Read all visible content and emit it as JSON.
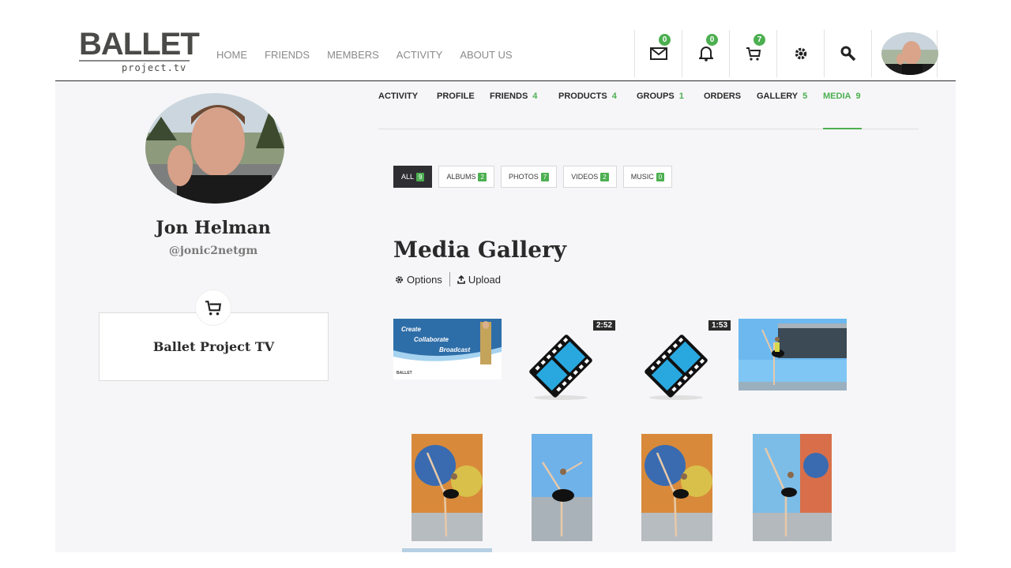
{
  "brand": {
    "logo_main": "BALLET",
    "logo_sub": "project.tv"
  },
  "main_nav": [
    "HOME",
    "FRIENDS",
    "MEMBERS",
    "ACTIVITY",
    "ABOUT US"
  ],
  "header_icons": {
    "messages_count": "0",
    "notifications_count": "0",
    "cart_count": "7"
  },
  "profile": {
    "name": "Jon Helman",
    "handle": "@jonic2netgm"
  },
  "shop": {
    "name": "Ballet Project TV"
  },
  "profile_tabs": [
    {
      "label": "ACTIVITY",
      "count": ""
    },
    {
      "label": "PROFILE",
      "count": ""
    },
    {
      "label": "FRIENDS",
      "count": "4"
    },
    {
      "label": "PRODUCTS",
      "count": "4"
    },
    {
      "label": "GROUPS",
      "count": "1"
    },
    {
      "label": "ORDERS",
      "count": ""
    },
    {
      "label": "GALLERY",
      "count": "5"
    },
    {
      "label": "MEDIA",
      "count": "9"
    }
  ],
  "active_tab": "MEDIA",
  "filters": [
    {
      "label": "ALL",
      "count": "9"
    },
    {
      "label": "ALBUMS",
      "count": "2"
    },
    {
      "label": "PHOTOS",
      "count": "7"
    },
    {
      "label": "VIDEOS",
      "count": "2"
    },
    {
      "label": "MUSIC",
      "count": "0"
    }
  ],
  "gallery": {
    "title": "Media Gallery",
    "options_label": "Options",
    "upload_label": "Upload",
    "banner_text": [
      "Create",
      "Collaborate",
      "Broadcast"
    ],
    "banner_logo": "BALLET",
    "video_durations": [
      "2:52",
      "1:53"
    ]
  },
  "colors": {
    "accent": "#4caf50",
    "dark": "#2f2f33",
    "page_bg": "#f6f6f8"
  }
}
